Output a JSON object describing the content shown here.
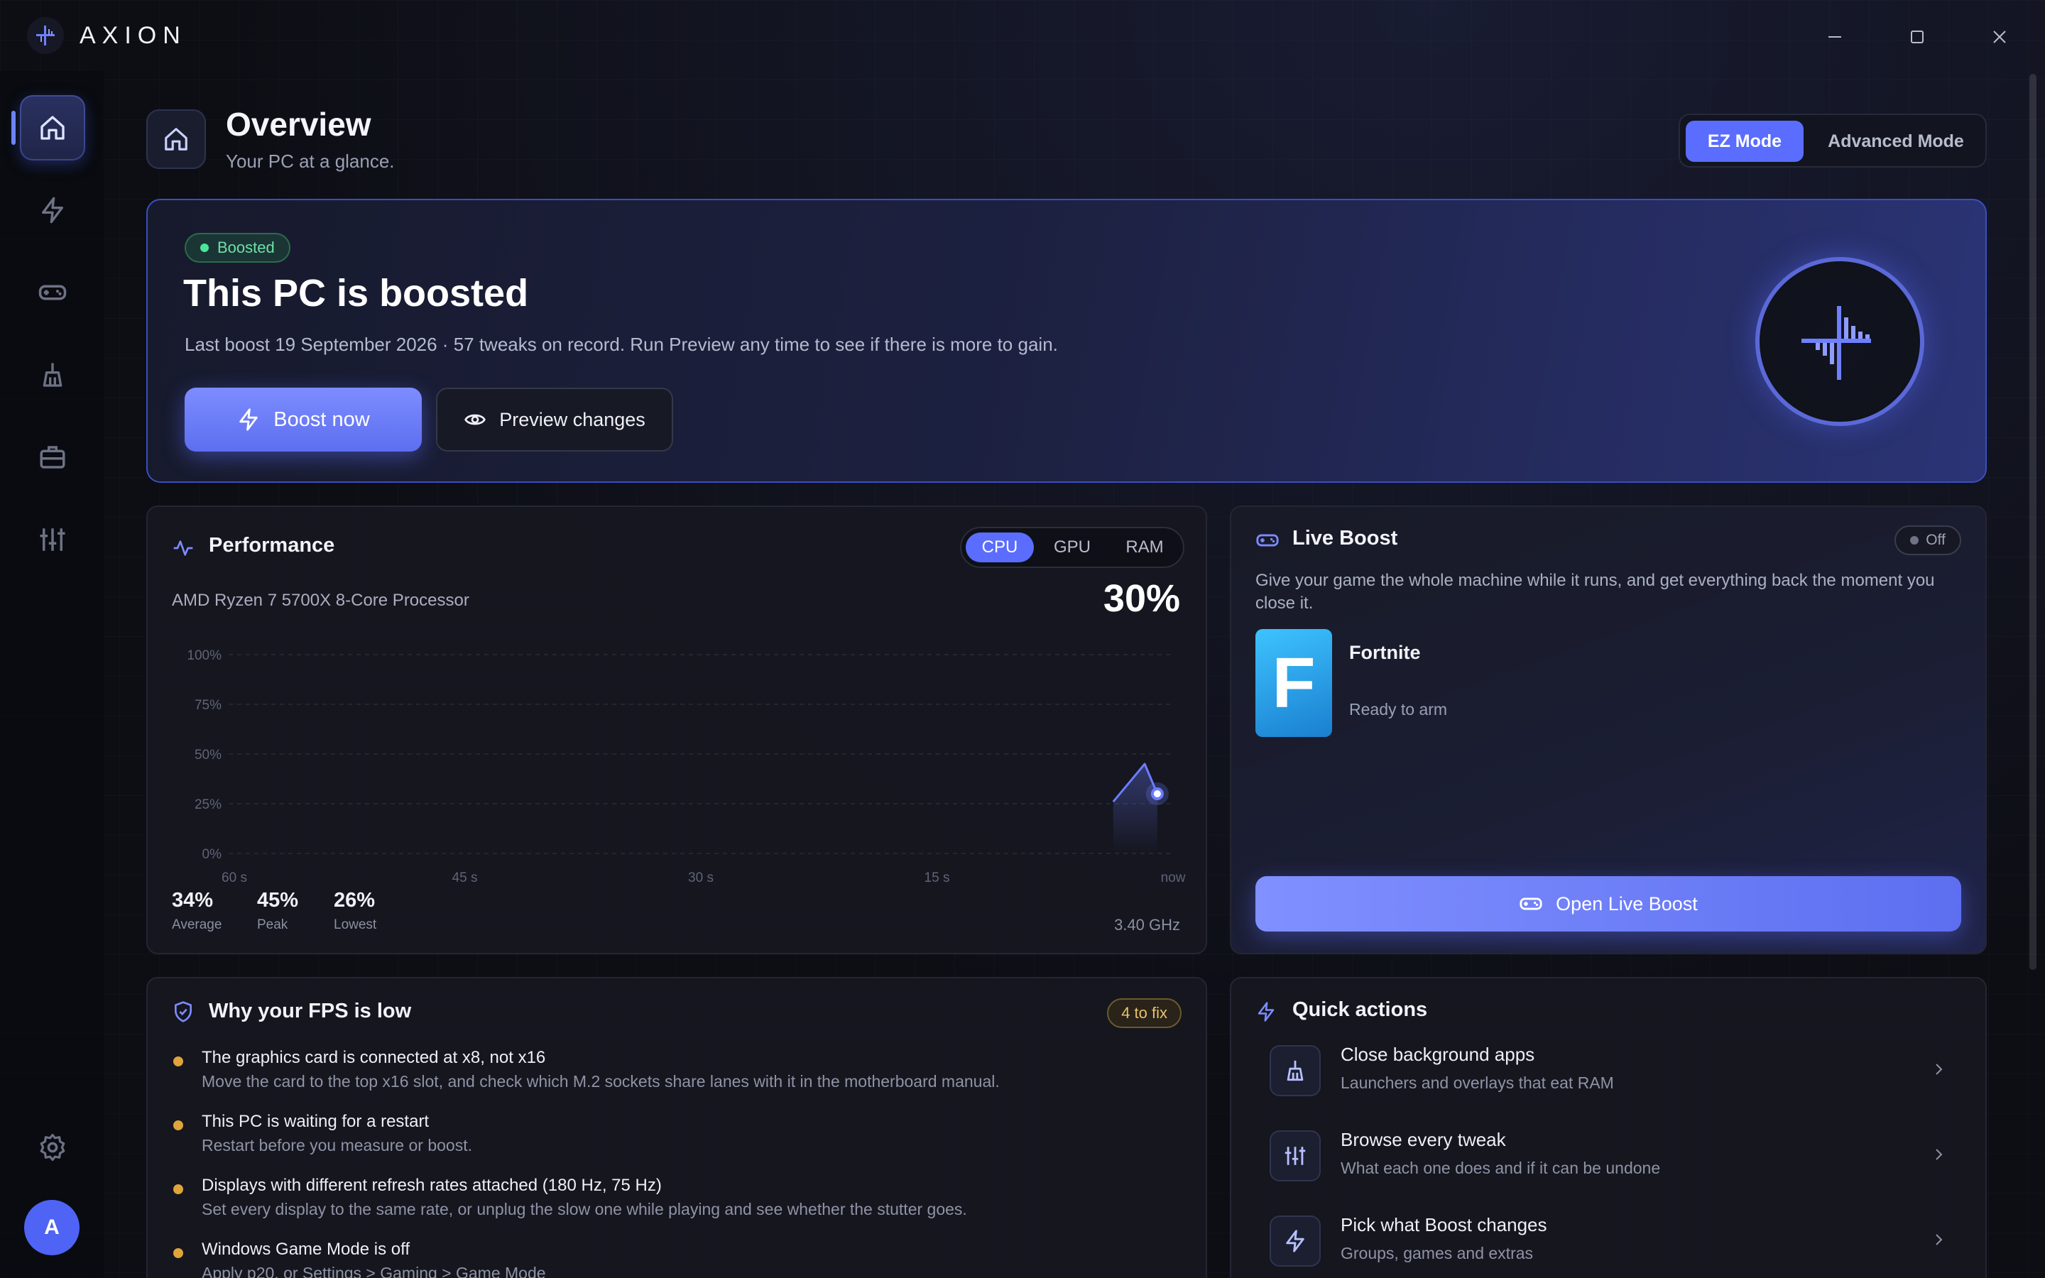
{
  "app": {
    "name": "AXION"
  },
  "nav": {
    "items": [
      {
        "name": "home",
        "icon": "home-icon"
      },
      {
        "name": "boost",
        "icon": "bolt-icon"
      },
      {
        "name": "games",
        "icon": "gamepad-icon"
      },
      {
        "name": "clean",
        "icon": "broom-icon"
      },
      {
        "name": "toolbox",
        "icon": "briefcase-icon"
      },
      {
        "name": "tweaks",
        "icon": "sliders-icon"
      }
    ],
    "settings_icon": "gear-icon",
    "avatar_initial": "A"
  },
  "header": {
    "title": "Overview",
    "subtitle": "Your PC at a glance.",
    "modes": {
      "ez": "EZ Mode",
      "advanced": "Advanced Mode",
      "selected": "EZ Mode"
    }
  },
  "hero": {
    "badge": "Boosted",
    "title": "This PC is boosted",
    "subtitle": "Last boost 19 September 2026  ·  57 tweaks on record. Run Preview any time to see if there is more to gain.",
    "boost_button": "Boost now",
    "preview_button": "Preview changes"
  },
  "performance": {
    "title": "Performance",
    "tabs": [
      "CPU",
      "GPU",
      "RAM"
    ],
    "active_tab": "CPU",
    "device": "AMD Ryzen 7 5700X 8-Core Processor",
    "current": "30%",
    "stats": [
      {
        "value": "34%",
        "label": "Average"
      },
      {
        "value": "45%",
        "label": "Peak"
      },
      {
        "value": "26%",
        "label": "Lowest"
      }
    ],
    "clock": "3.40 GHz"
  },
  "chart_data": {
    "type": "line",
    "title": "",
    "xlabel": "",
    "ylabel": "",
    "x_ticks": [
      "60 s",
      "45 s",
      "30 s",
      "15 s",
      "now"
    ],
    "y_ticks": [
      "100%",
      "75%",
      "50%",
      "25%",
      "0%"
    ],
    "ylim": [
      0,
      100
    ],
    "xlim": [
      -60,
      0
    ],
    "grid": true,
    "series": [
      {
        "x": [
          -3.8,
          -1.8,
          -1.0
        ],
        "y": [
          26,
          45,
          30
        ]
      }
    ],
    "color": "#6b7cff"
  },
  "live_boost": {
    "title": "Live Boost",
    "toggle": "Off",
    "description": "Give your game the whole machine while it runs, and get everything back the moment you close it.",
    "game": {
      "initial": "F",
      "name": "Fortnite",
      "status": "Ready to arm"
    },
    "button": "Open Live Boost"
  },
  "fps": {
    "title": "Why your FPS is low",
    "badge": "4 to fix",
    "issues": [
      {
        "title": "The graphics card is connected at x8, not x16",
        "desc": "Move the card to the top x16 slot, and check which M.2 sockets share lanes with it in the motherboard manual."
      },
      {
        "title": "This PC is waiting for a restart",
        "desc": "Restart before you measure or boost."
      },
      {
        "title": "Displays with different refresh rates attached (180 Hz, 75 Hz)",
        "desc": "Set every display to the same rate, or unplug the slow one while playing and see whether the stutter goes."
      },
      {
        "title": "Windows Game Mode is off",
        "desc": "Apply p20, or Settings > Gaming > Game Mode"
      }
    ]
  },
  "quick_actions": {
    "title": "Quick actions",
    "items": [
      {
        "title": "Close background apps",
        "sub": "Launchers and overlays that eat RAM",
        "icon": "broom-icon"
      },
      {
        "title": "Browse every tweak",
        "sub": "What each one does and if it can be undone",
        "icon": "sliders-icon"
      },
      {
        "title": "Pick what Boost changes",
        "sub": "Groups, games and extras",
        "icon": "bolt-icon"
      }
    ]
  },
  "colors": {
    "accent": "#5a6dff",
    "success": "#4ee39a",
    "warning": "#e0a43a"
  }
}
